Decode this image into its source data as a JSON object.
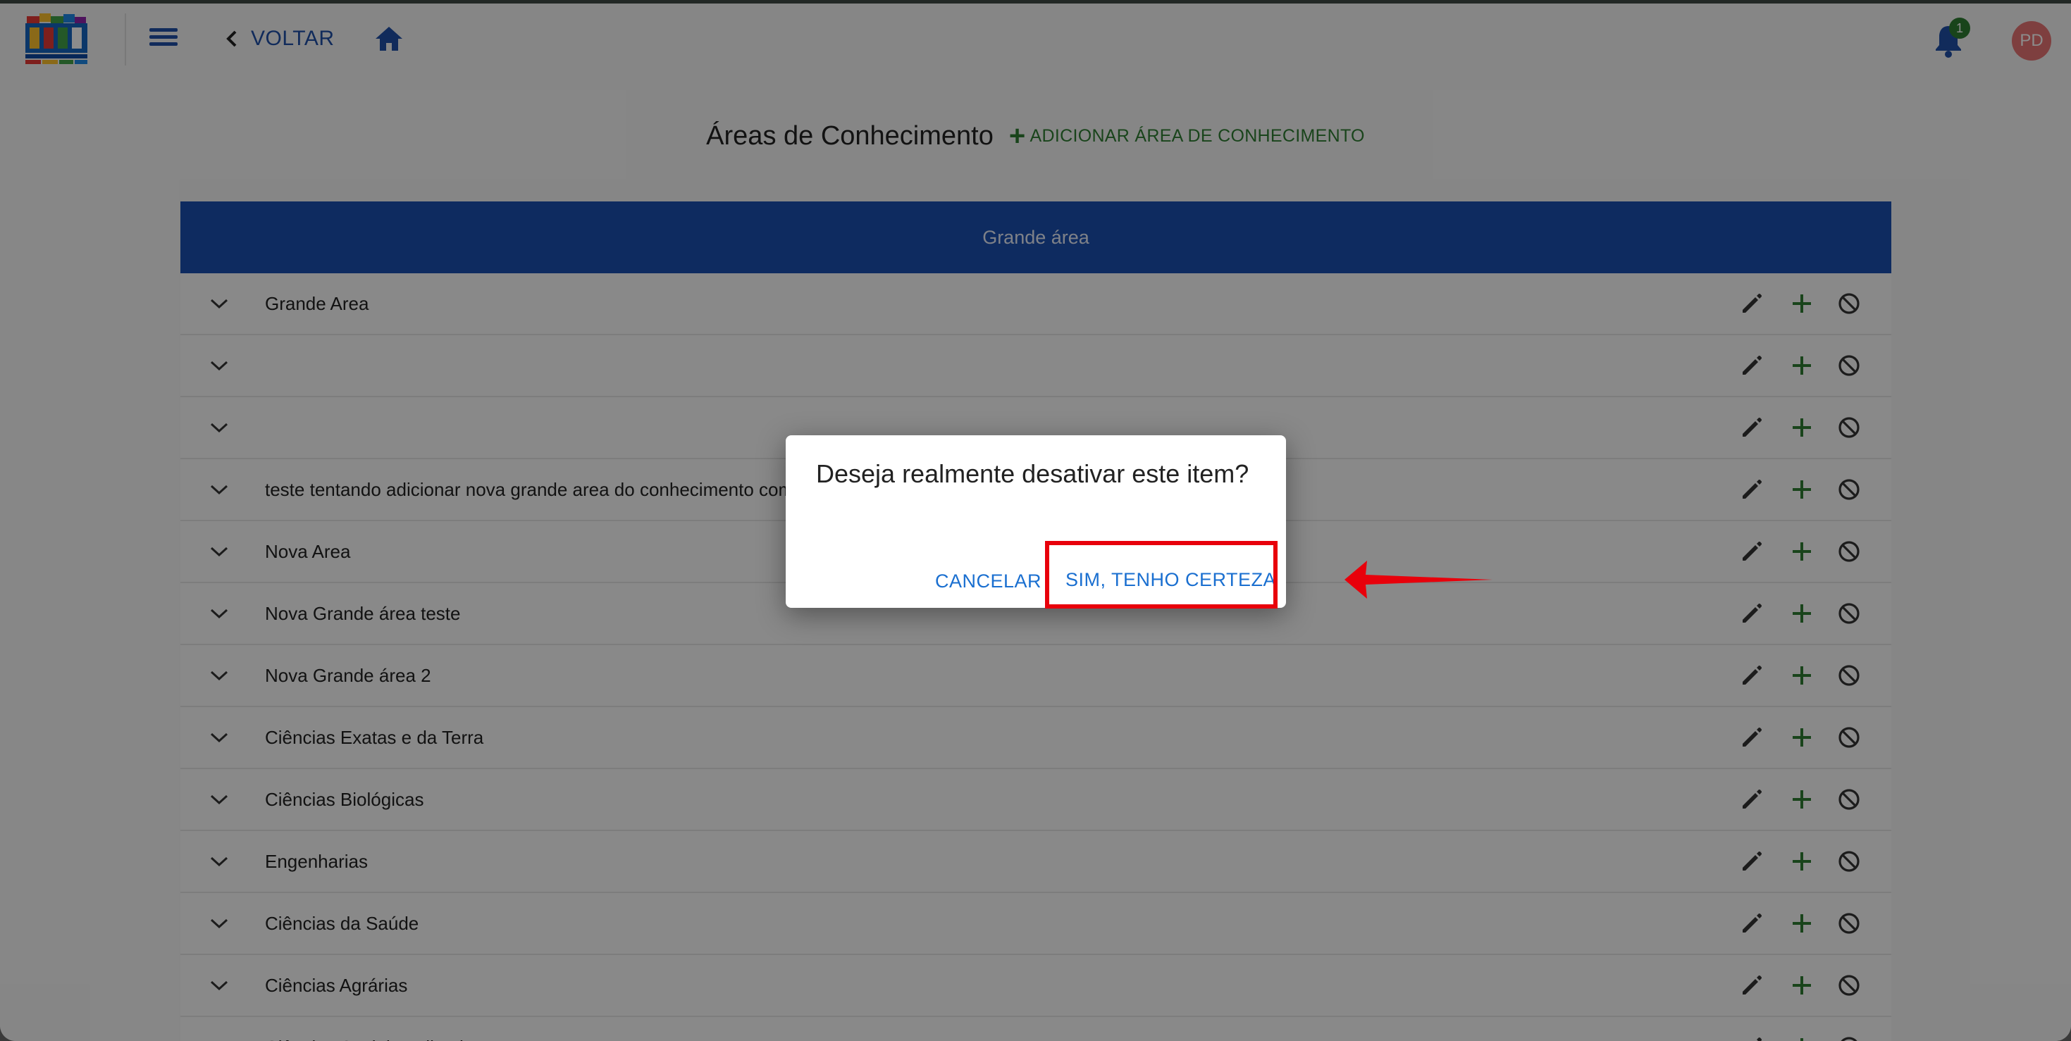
{
  "header": {
    "back_label": "VOLTAR",
    "notification_count": "1",
    "avatar_initials": "PD"
  },
  "page": {
    "title": "Áreas de Conhecimento",
    "add_label": "ADICIONAR ÁREA DE CONHECIMENTO"
  },
  "table": {
    "header": "Grande área",
    "rows": [
      "Grande Area",
      "",
      "",
      "teste tentando adicionar nova grande area do conhecimento com",
      "Nova Area",
      "Nova Grande área teste",
      "Nova Grande área 2",
      "Ciências Exatas e da Terra",
      "Ciências Biológicas",
      "Engenharias",
      "Ciências da Saúde",
      "Ciências Agrárias",
      "Ciências Sociais Aplicadas"
    ]
  },
  "dialog": {
    "title": "Deseja realmente desativar este item?",
    "cancel_label": "CANCELAR",
    "confirm_label": "SIM, TENHO CERTEZA"
  },
  "colors": {
    "primary": "#1a4fb0",
    "accent_green": "#2e7d32",
    "link_blue": "#1a6fd0",
    "annotation_red": "#e8000b"
  }
}
